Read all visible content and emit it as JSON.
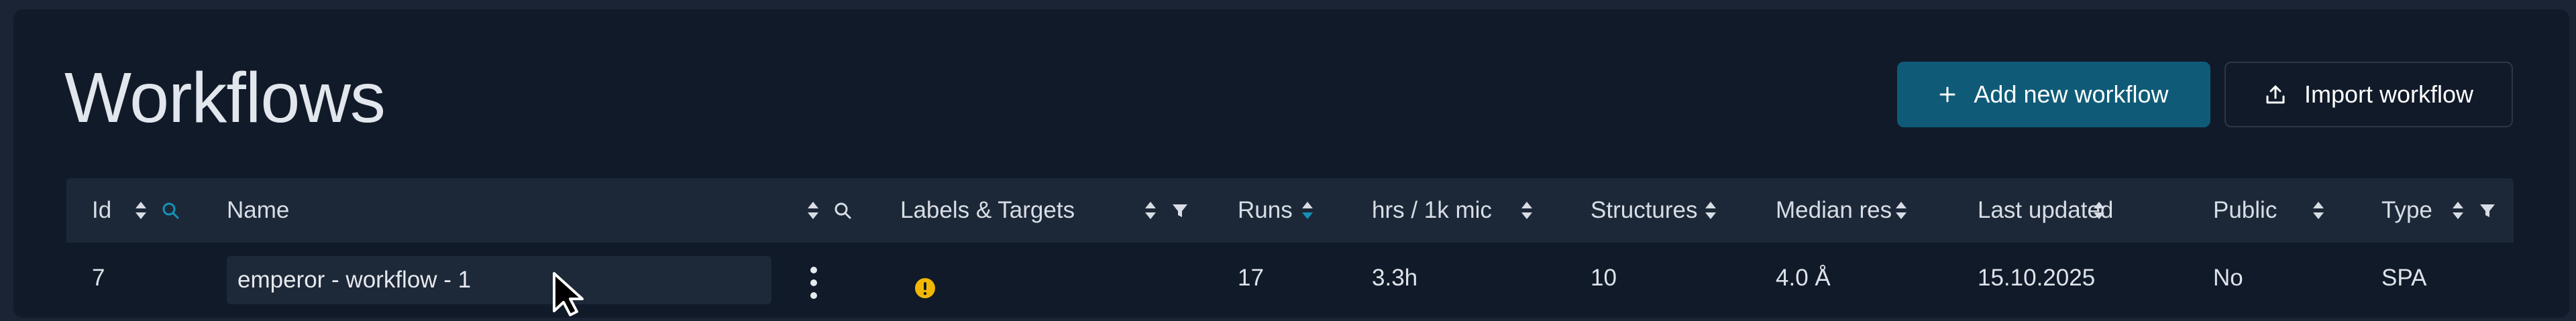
{
  "page": {
    "title": "Workflows",
    "add_button_label": "Add new workflow",
    "import_button_label": "Import workflow"
  },
  "colors": {
    "page_bg": "#1b2434",
    "panel_bg": "#111a29",
    "header_bg": "#1c2838",
    "accent": "#0f5b77",
    "sort_active": "#1592b8",
    "warning": "#f2b705"
  },
  "table": {
    "columns": [
      {
        "key": "id",
        "label": "Id",
        "controls": [
          "sort-icon",
          "search-icon"
        ]
      },
      {
        "key": "name",
        "label": "Name",
        "controls": [
          "sort-icon",
          "search-icon"
        ]
      },
      {
        "key": "labels",
        "label": "Labels & Targets",
        "controls": [
          "sort-icon",
          "filter-icon"
        ]
      },
      {
        "key": "runs",
        "label": "Runs",
        "controls": [
          "sort-icon"
        ]
      },
      {
        "key": "hrs",
        "label": "hrs / 1k mic",
        "controls": [
          "sort-icon"
        ]
      },
      {
        "key": "structures",
        "label": "Structures",
        "controls": [
          "sort-icon"
        ]
      },
      {
        "key": "median_res",
        "label": "Median res",
        "controls": [
          "sort-icon"
        ]
      },
      {
        "key": "last_updated",
        "label": "Last updated",
        "controls": [
          "sort-icon"
        ]
      },
      {
        "key": "public",
        "label": "Public",
        "controls": [
          "sort-icon"
        ]
      },
      {
        "key": "type",
        "label": "Type",
        "controls": [
          "sort-icon",
          "filter-icon"
        ]
      }
    ],
    "rows": [
      {
        "id": "7",
        "name": "emperor - workflow - 1",
        "labels_icon": "warning-icon",
        "runs": "17",
        "hrs": "3.3h",
        "structures": "10",
        "median_res": "4.0 Å",
        "last_updated": "15.10.2025",
        "public": "No",
        "type": "SPA"
      }
    ]
  }
}
